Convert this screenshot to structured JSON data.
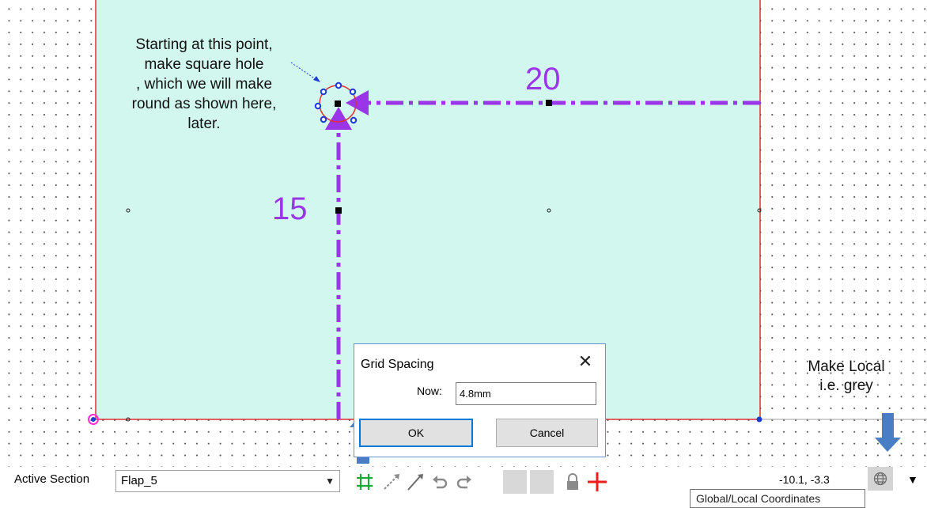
{
  "canvas": {
    "annotation_text": "Starting at this point,\nmake square hole\n, which we will make\nround as shown here,\nlater.",
    "dimension_horizontal": "20",
    "dimension_vertical": "15",
    "side_note": "Make Local\ni.e. grey",
    "colors": {
      "panel_fill": "#d2f7ee",
      "outline": "#e03030",
      "dimension_line": "#9a35e8",
      "callout_arrow": "#4a7ec4"
    }
  },
  "dialog": {
    "title": "Grid Spacing",
    "now_label": "Now:",
    "now_value": "4.8mm",
    "ok_label": "OK",
    "cancel_label": "Cancel",
    "close_symbol": "✕"
  },
  "toolbar": {
    "active_section_label": "Active Section",
    "active_section_value": "Flap_5",
    "tools": [
      "grid-icon",
      "snap-line-icon",
      "draw-line-icon",
      "undo-icon",
      "redo-icon",
      "blank-tool-icon",
      "blank-tool-icon",
      "lock-icon",
      "origin-icon"
    ],
    "coordinates": "-10.1, -3.3",
    "globe_icon": "globe-icon",
    "tooltip": "Global/Local Coordinates"
  }
}
